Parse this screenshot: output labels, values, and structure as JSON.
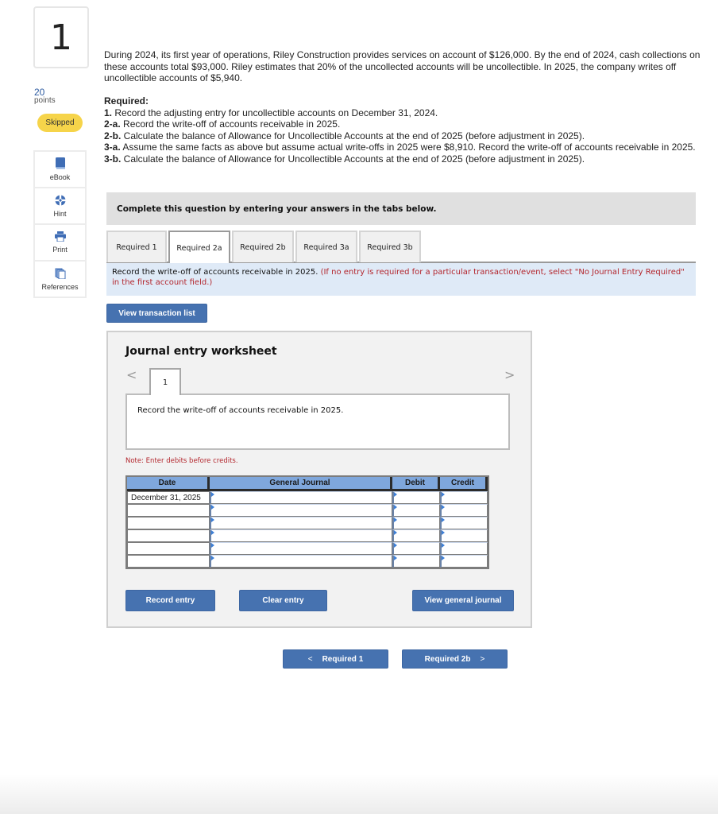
{
  "question": {
    "number": "1",
    "points_value": "20",
    "points_label": "points",
    "status": "Skipped"
  },
  "tools": [
    {
      "label": "eBook",
      "icon": "book-icon"
    },
    {
      "label": "Hint",
      "icon": "lifebuoy-icon"
    },
    {
      "label": "Print",
      "icon": "printer-icon"
    },
    {
      "label": "References",
      "icon": "documents-icon"
    }
  ],
  "problem_text": "During 2024, its first year of operations, Riley Construction provides services on account of $126,000. By the end of 2024, cash collections on these accounts total $93,000. Riley estimates that 20% of the uncollected accounts will be uncollectible. In 2025, the company writes off uncollectible accounts of $5,940.",
  "required": {
    "heading": "Required:",
    "items": [
      {
        "num": "1.",
        "text": " Record the adjusting entry for uncollectible accounts on December 31, 2024."
      },
      {
        "num": "2-a.",
        "text": " Record the write-off of accounts receivable in 2025."
      },
      {
        "num": "2-b.",
        "text": " Calculate the balance of Allowance for Uncollectible Accounts at the end of 2025 (before adjustment in 2025)."
      },
      {
        "num": "3-a.",
        "text": " Assume the same facts as above but assume actual write-offs in 2025 were $8,910. Record the write-off of accounts receivable in 2025."
      },
      {
        "num": "3-b.",
        "text": " Calculate the balance of Allowance for Uncollectible Accounts at the end of 2025 (before adjustment in 2025)."
      }
    ]
  },
  "banner": "Complete this question by entering your answers in the tabs below.",
  "tabs": [
    {
      "label": "Required 1",
      "active": false
    },
    {
      "label": "Required 2a",
      "active": true
    },
    {
      "label": "Required 2b",
      "active": false
    },
    {
      "label": "Required 3a",
      "active": false
    },
    {
      "label": "Required 3b",
      "active": false
    }
  ],
  "instruction": {
    "main": "Record the write-off of accounts receivable in 2025.",
    "note": "(If no entry is required for a particular transaction/event, select \"No Journal Entry Required\" in the first account field.)"
  },
  "view_transaction_list": "View transaction list",
  "worksheet": {
    "title": "Journal entry worksheet",
    "prev": "<",
    "next": ">",
    "entry_tab": "1",
    "description": "Record the write-off of accounts receivable in 2025.",
    "note": "Note: Enter debits before credits.",
    "columns": [
      "Date",
      "General Journal",
      "Debit",
      "Credit"
    ],
    "rows": [
      {
        "date": "December 31, 2025",
        "account": "",
        "debit": "",
        "credit": ""
      },
      {
        "date": "",
        "account": "",
        "debit": "",
        "credit": ""
      },
      {
        "date": "",
        "account": "",
        "debit": "",
        "credit": ""
      },
      {
        "date": "",
        "account": "",
        "debit": "",
        "credit": ""
      },
      {
        "date": "",
        "account": "",
        "debit": "",
        "credit": ""
      },
      {
        "date": "",
        "account": "",
        "debit": "",
        "credit": ""
      }
    ],
    "buttons": {
      "record": "Record entry",
      "clear": "Clear entry",
      "view_journal": "View general journal"
    }
  },
  "nav": {
    "prev_label": "Required 1",
    "next_label": "Required 2b",
    "prev_arrow": "<",
    "next_arrow": ">"
  },
  "colors": {
    "accent": "#4672b0",
    "skipped_badge": "#f6d44a",
    "note_red": "#b3262d",
    "table_header": "#7fa7dc"
  }
}
